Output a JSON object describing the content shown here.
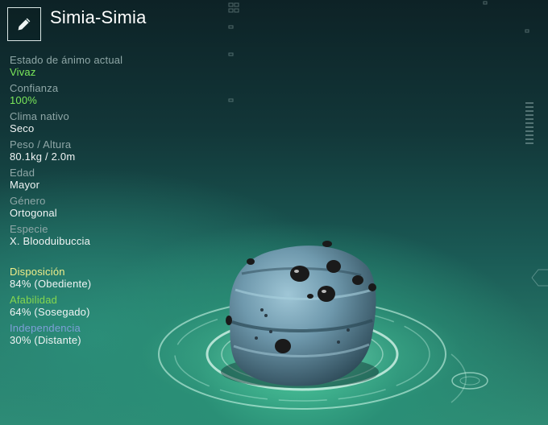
{
  "header": {
    "edit_icon": "pencil-icon",
    "title": "Simia-Simia"
  },
  "stats": [
    {
      "label": "Estado de ánimo actual",
      "value": "Vivaz",
      "highlight": true
    },
    {
      "label": "Confianza",
      "value": "100%",
      "highlight": true
    },
    {
      "label": "Clima nativo",
      "value": "Seco",
      "highlight": false
    },
    {
      "label": "Peso / Altura",
      "value": "80.1kg / 2.0m",
      "highlight": false
    },
    {
      "label": "Edad",
      "value": "Mayor",
      "highlight": false
    },
    {
      "label": "Género",
      "value": "Ortogonal",
      "highlight": false
    },
    {
      "label": "Especie",
      "value": "X. Blooduibuccia",
      "highlight": false
    }
  ],
  "traits": [
    {
      "label": "Disposición",
      "value": "84% (Obediente)",
      "color": "#f1ee8a"
    },
    {
      "label": "Afabilidad",
      "value": "64% (Sosegado)",
      "color": "#84d64f"
    },
    {
      "label": "Independencia",
      "value": "30% (Distante)",
      "color": "#7e9fd8"
    }
  ],
  "colors": {
    "highlight_value": "#7be85a",
    "label": "#8fa7a7",
    "value": "#f0f4f4"
  }
}
